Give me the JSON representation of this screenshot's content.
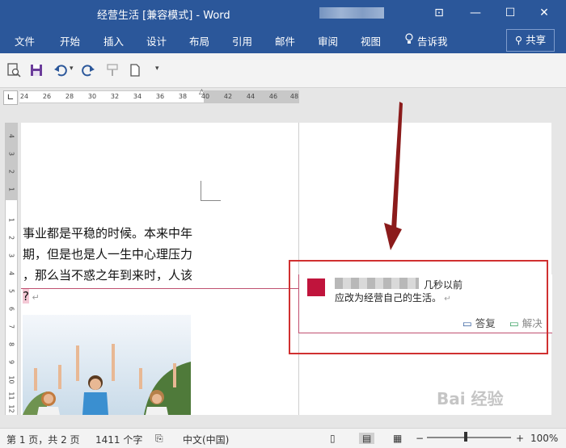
{
  "window": {
    "title": "经营生活 [兼容模式] - Word"
  },
  "ribbon": {
    "tabs": [
      "文件",
      "开始",
      "插入",
      "设计",
      "布局",
      "引用",
      "邮件",
      "审阅",
      "视图"
    ],
    "tell_me": "告诉我",
    "share": "共享"
  },
  "ruler": {
    "horizontal_ticks": [
      "24",
      "26",
      "28",
      "30",
      "32",
      "34",
      "36",
      "38",
      "40",
      "42",
      "44",
      "46",
      "48"
    ],
    "vertical_ticks": [
      "4",
      "3",
      "2",
      "1",
      "1",
      "2",
      "3",
      "4",
      "5",
      "6",
      "7",
      "8",
      "9",
      "10",
      "11",
      "12"
    ]
  },
  "document": {
    "lines": [
      "事业都是平稳的时候。本来中年",
      "期，但是也是人一生中心理压力",
      "，那么当不惑之年到来时，人该",
      "?"
    ]
  },
  "comment": {
    "time": "几秒以前",
    "text": "应改为经营自己的生活。",
    "reply_label": "答复",
    "resolve_label": "解决"
  },
  "status": {
    "page": "第 1 页，共 2 页",
    "words": "1411 个字",
    "language": "中文(中国)",
    "zoom": "100%"
  },
  "colors": {
    "accent": "#2b579a",
    "comment_border": "#c05070",
    "highlight_box": "#d03030"
  },
  "watermark": "Bai 经验"
}
